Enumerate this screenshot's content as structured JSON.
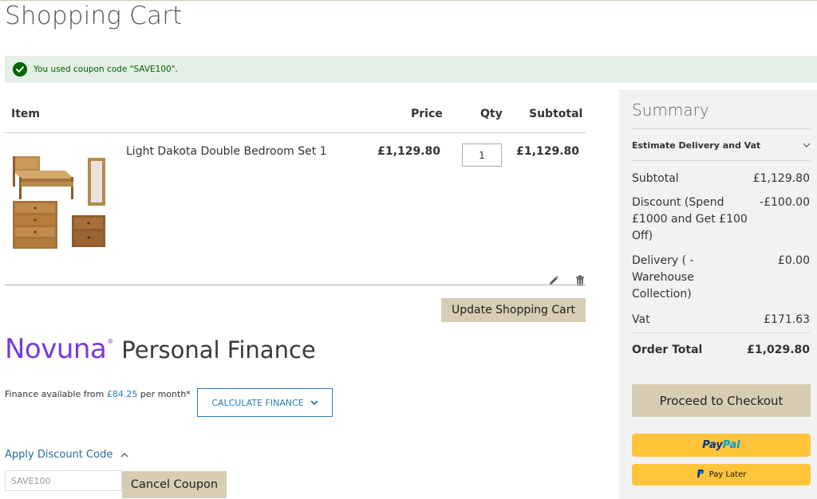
{
  "page": {
    "title": "Shopping Cart"
  },
  "notice": {
    "message": "You used coupon code \"SAVE100\"."
  },
  "cart": {
    "headers": {
      "item": "Item",
      "price": "Price",
      "qty": "Qty",
      "subtotal": "Subtotal"
    },
    "items": [
      {
        "name": "Light Dakota Double Bedroom Set 1",
        "price": "£1,129.80",
        "qty": "1",
        "subtotal": "£1,129.80"
      }
    ],
    "update_label": "Update Shopping Cart"
  },
  "finance": {
    "brand": "Novuna",
    "registered": "®",
    "product": "Personal Finance",
    "prefix": "Finance available from ",
    "amount": "£84.25",
    "suffix": " per month*",
    "calculate_label": "CALCULATE FINANCE"
  },
  "discount": {
    "link_label": "Apply Discount Code",
    "code_value": "SAVE100",
    "cancel_label": "Cancel Coupon"
  },
  "summary": {
    "title": "Summary",
    "estimate_label": "Estimate Delivery and Vat",
    "rows": [
      {
        "label": "Subtotal",
        "value": "£1,129.80"
      },
      {
        "label": "Discount (Spend £1000 and Get £100 Off)",
        "value": "-£100.00"
      },
      {
        "label": "Delivery ( - Warehouse Collection)",
        "value": "£0.00"
      },
      {
        "label": "Vat",
        "value": "£171.63"
      }
    ],
    "total": {
      "label": "Order Total",
      "value": "£1,029.80"
    },
    "checkout_label": "Proceed to Checkout",
    "paypal": {
      "pay": "Pay",
      "pal": "Pal",
      "pay_color": "#003087",
      "pal_color": "#009cde"
    },
    "paylater_label": "Pay Later"
  },
  "colors": {
    "success": "#006400",
    "success_bg": "#e5efe5",
    "accent_blue": "#2a7ab8",
    "button_beige": "#d6cdb4",
    "novuna_purple": "#7a3ad8",
    "paypal_yellow": "#ffc439"
  },
  "icons": [
    "check-circle-icon",
    "pencil-icon",
    "trash-icon",
    "chevron-down-icon",
    "chevron-up-icon",
    "paypal-p-icon"
  ]
}
